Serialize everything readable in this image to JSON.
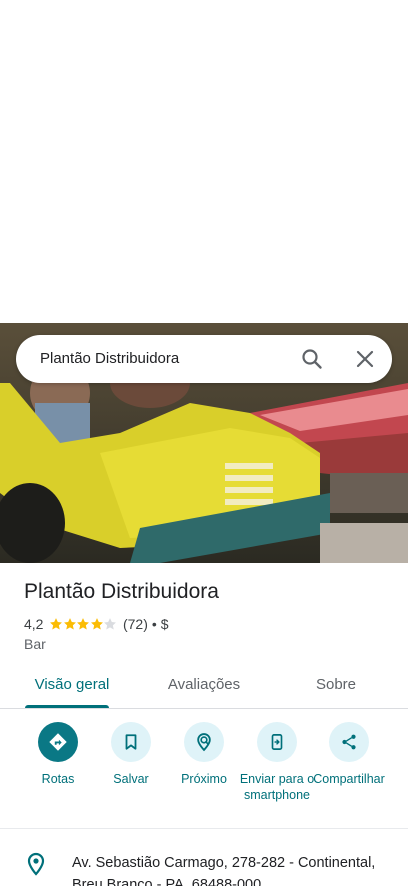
{
  "search": {
    "query": "Plantão Distribuidora"
  },
  "place": {
    "name": "Plantão Distribuidora",
    "rating": "4,2",
    "stars_filled": 4,
    "stars_total": 5,
    "review_count": "(72)",
    "separator": "•",
    "price": "$",
    "category": "Bar"
  },
  "tabs": [
    {
      "label": "Visão geral",
      "selected": true
    },
    {
      "label": "Avaliações",
      "selected": false
    },
    {
      "label": "Sobre",
      "selected": false
    }
  ],
  "actions": [
    {
      "label": "Rotas",
      "icon": "directions-icon"
    },
    {
      "label": "Salvar",
      "icon": "bookmark-icon"
    },
    {
      "label": "Próximo",
      "icon": "nearby-icon"
    },
    {
      "label": "Enviar para o smartphone",
      "icon": "send-to-phone-icon"
    },
    {
      "label": "Compartilhar",
      "icon": "share-icon"
    }
  ],
  "address": {
    "text": "Av. Sebastião Carmago, 278-282 - Continental, Breu Branco - PA, 68488-000"
  },
  "colors": {
    "accent": "#00707a",
    "action_primary": "#0a7885",
    "action_secondary_bg": "#dff3f8",
    "star": "#fbbc04",
    "star_empty": "#dadce0"
  }
}
